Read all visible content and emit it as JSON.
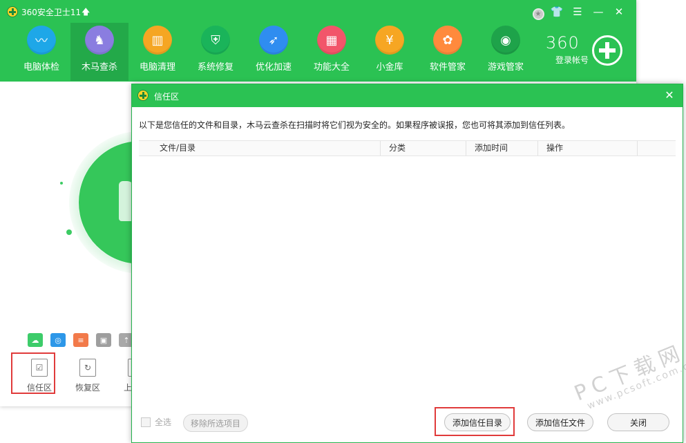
{
  "app": {
    "title": "360安全卫士11",
    "upgrade_glyph": "🡅",
    "brand": "360",
    "login_label": "登录帐号",
    "colors": {
      "primary": "#2bc253",
      "active_nav": "#23a949",
      "highlight": "#e03a3a"
    }
  },
  "window_controls": {
    "medal_icon": "medal-icon",
    "skin": "👕",
    "menu": "☰",
    "minimize": "—",
    "close": "✕"
  },
  "nav": {
    "items": [
      {
        "label": "电脑体检",
        "icon": "monitor-icon",
        "glyph": "〰",
        "color": "#1ea7e8"
      },
      {
        "label": "木马查杀",
        "icon": "horse-icon",
        "glyph": "♞",
        "color": "#8a7de0"
      },
      {
        "label": "电脑清理",
        "icon": "broom-icon",
        "glyph": "▥",
        "color": "#f5a623"
      },
      {
        "label": "系统修复",
        "icon": "shield-icon",
        "glyph": "⛨",
        "color": "#1ab45a"
      },
      {
        "label": "优化加速",
        "icon": "rocket-icon",
        "glyph": "➶",
        "color": "#2f8df0"
      },
      {
        "label": "功能大全",
        "icon": "grid-icon",
        "glyph": "▦",
        "color": "#f2556a"
      },
      {
        "label": "小金库",
        "icon": "money-bag-icon",
        "glyph": "¥",
        "color": "#f6a623"
      },
      {
        "label": "软件管家",
        "icon": "software-icon",
        "glyph": "✿",
        "color": "#ff8a3d"
      },
      {
        "label": "游戏管家",
        "icon": "gamepad-icon",
        "glyph": "◉",
        "color": "#1ea34a"
      }
    ]
  },
  "side_icons": [
    {
      "icon": "cloud-icon",
      "glyph": "☁",
      "color": "#3dcc6a"
    },
    {
      "icon": "sync-icon",
      "glyph": "◎",
      "color": "#2d97e8"
    },
    {
      "icon": "list-icon",
      "glyph": "≡",
      "color": "#f27a4a"
    },
    {
      "icon": "image-icon",
      "glyph": "▣",
      "color": "#9e9e9e"
    },
    {
      "icon": "upload-cloud-icon",
      "glyph": "⇡",
      "color": "#a8a8a8"
    }
  ],
  "tools": [
    {
      "label": "信任区",
      "icon": "trust-zone-icon",
      "glyph": "☑"
    },
    {
      "label": "恢复区",
      "icon": "restore-icon",
      "glyph": "↻"
    },
    {
      "label": "上报区",
      "icon": "report-icon",
      "glyph": "↑"
    }
  ],
  "dialog": {
    "title": "信任区",
    "close": "✕",
    "description": "以下是您信任的文件和目录，木马云查杀在扫描时将它们视为安全的。如果程序被误报，您也可将其添加到信任列表。",
    "columns": [
      "文件/目录",
      "分类",
      "添加时间",
      "操作"
    ],
    "select_all_label": "全选",
    "remove_selected_label": "移除所选项目",
    "add_dir_label": "添加信任目录",
    "add_file_label": "添加信任文件",
    "close_label": "关闭"
  },
  "watermark": {
    "line1": "PC下载网",
    "line2": "www.pcsoft.com.cn"
  }
}
